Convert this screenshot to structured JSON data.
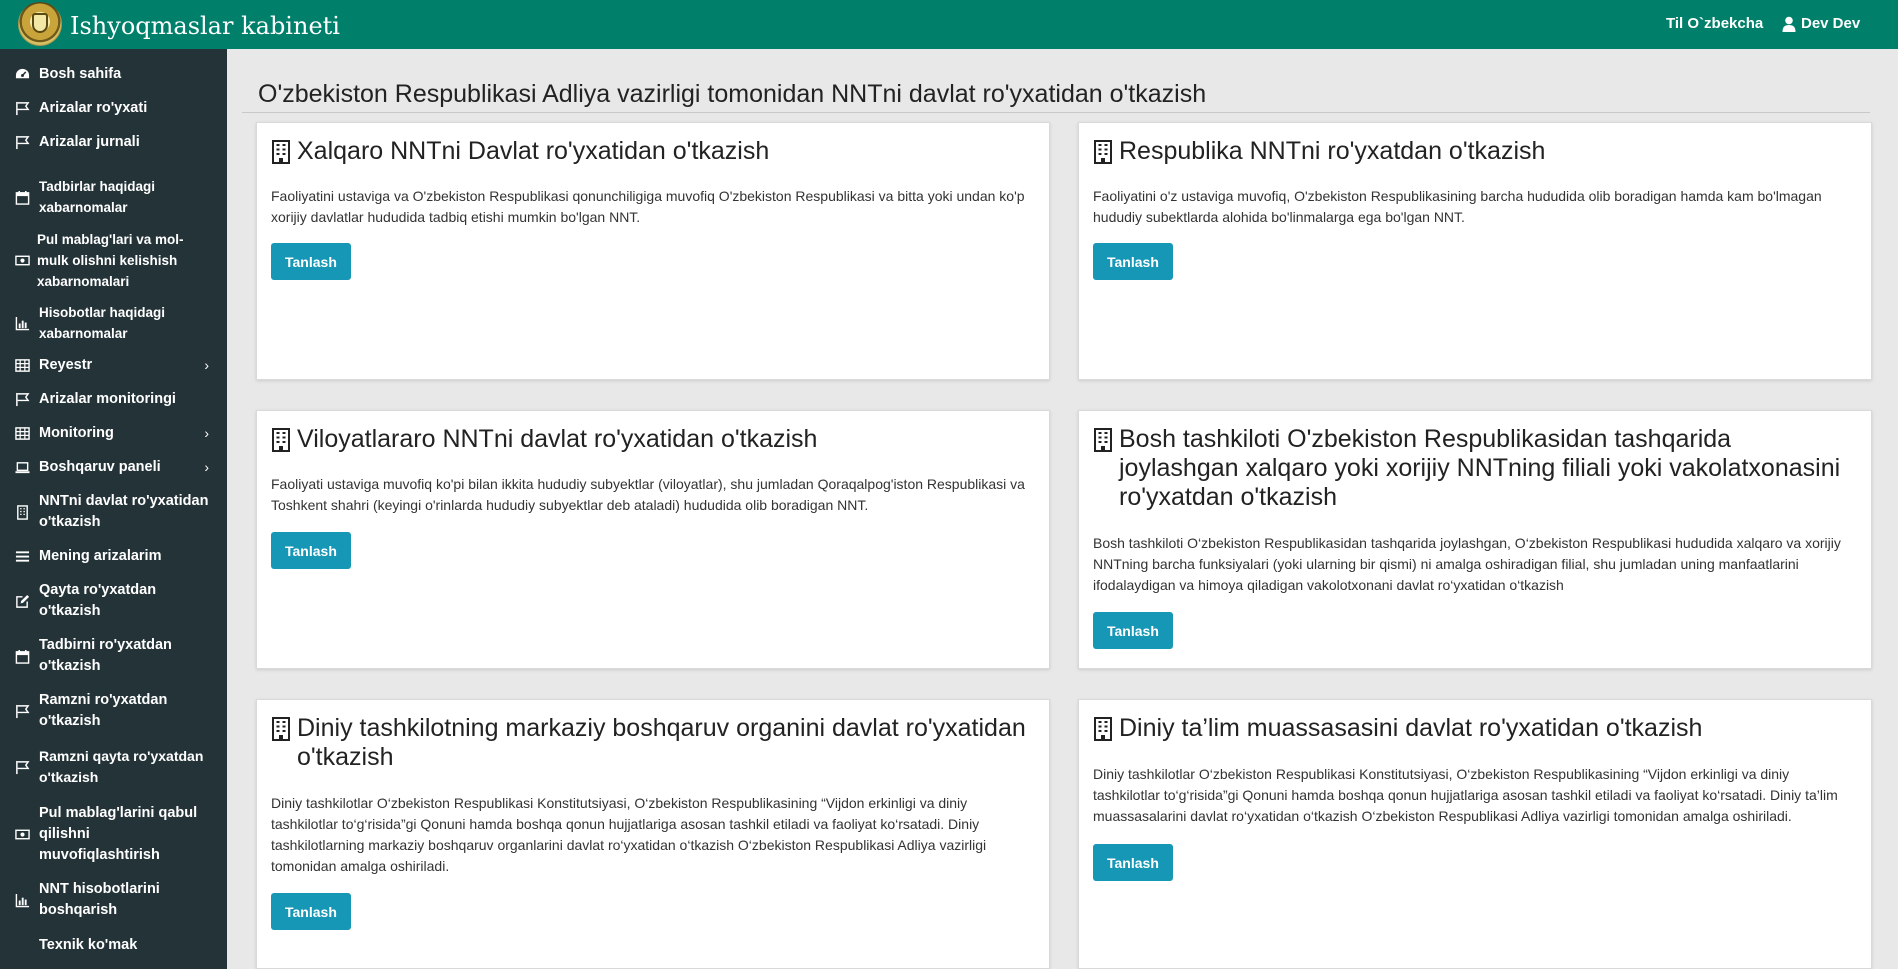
{
  "header": {
    "app_title": "Ishyoqmaslar kabineti",
    "language": "Til O`zbekcha",
    "user": "Dev Dev"
  },
  "colors": {
    "header": "#00806a",
    "sidebar": "#243338",
    "button": "#1797b6"
  },
  "sidebar": {
    "items": [
      {
        "label": "Bosh sahifa",
        "icon": "dashboard-icon"
      },
      {
        "label": "Arizalar ro'yxati",
        "icon": "flag-icon"
      },
      {
        "label": "Arizalar jurnali",
        "icon": "flag-icon"
      },
      {
        "label": "Tadbirlar haqidagi xabarnomalar",
        "icon": "calendar-icon"
      },
      {
        "label": "Pul mablag'lari va mol-mulk olishni kelishish xabarnomalari",
        "icon": "money-icon"
      },
      {
        "label": "Hisobotlar haqidagi xabarnomalar",
        "icon": "bar-chart-icon"
      },
      {
        "label": "Reyestr",
        "icon": "table-icon",
        "chevron": "›"
      },
      {
        "label": "Arizalar monitoringi",
        "icon": "flag-icon"
      },
      {
        "label": "Monitoring",
        "icon": "table-icon",
        "chevron": "›"
      },
      {
        "label": "Boshqaruv paneli",
        "icon": "laptop-icon",
        "chevron": "›"
      },
      {
        "label": "NNTni davlat ro'yxatidan o'tkazish",
        "icon": "building-icon"
      },
      {
        "label": "Mening arizalarim",
        "icon": "list-icon"
      },
      {
        "label": "Qayta ro'yxatdan o'tkazish",
        "icon": "edit-icon"
      },
      {
        "label": "Tadbirni ro'yxatdan o'tkazish",
        "icon": "calendar-icon"
      },
      {
        "label": "Ramzni ro'yxatdan o'tkazish",
        "icon": "flag-icon"
      },
      {
        "label": "Ramzni qayta ro'yxatdan o'tkazish",
        "icon": "flag-icon"
      },
      {
        "label": "Pul mablag'larini qabul qilishni muvofiqlashtirish",
        "icon": "money-icon"
      },
      {
        "label": "NNT hisobotlarini boshqarish",
        "icon": "bar-chart-icon"
      },
      {
        "label": "Texnik ko'mak",
        "icon": "help-icon"
      }
    ]
  },
  "main": {
    "page_title": "O'zbekiston Respublikasi Adliya vazirligi tomonidan NNTni davlat ro'yxatidan o'tkazish",
    "button_label": "Tanlash",
    "cards": [
      {
        "title": "Xalqaro NNTni Davlat ro'yxatidan o'tkazish",
        "description": "Faoliyatini ustaviga va O'zbekiston Respublikasi qonunchiligiga muvofiq O'zbekiston Respublikasi va bitta yoki undan ko'p xorijiy davlatlar hududida tadbiq etishi mumkin bo'lgan NNT."
      },
      {
        "title": "Respublika NNTni ro'yxatdan o'tkazish",
        "description": "Faoliyatini o'z ustaviga muvofiq, O'zbekiston Respublikasining barcha hududida olib boradigan hamda kam bo'lmagan hududiy subektlarda alohida bo'linmalarga ega bo'lgan NNT."
      },
      {
        "title": "Viloyatlararo NNTni davlat ro'yxatidan o'tkazish",
        "description": "Faoliyati ustaviga muvofiq ko'pi bilan ikkita hududiy subyektlar (viloyatlar), shu jumladan Qoraqalpog'iston Respublikasi va Toshkent shahri (keyingi o'rinlarda hududiy subyektlar deb ataladi) hududida olib boradigan NNT."
      },
      {
        "title": "Bosh tashkiloti O'zbekiston Respublikasidan tashqarida joylashgan xalqaro yoki xorijiy NNTning filiali yoki vakolatxonasini ro'yxatdan o'tkazish",
        "description": "Bosh tashkiloti O‘zbekiston Respublikasidan tashqarida joylashgan, O‘zbekiston Respublikasi hududida xalqaro va xorijiy NNTning barcha funksiyalari (yoki ularning bir qismi) ni amalga oshiradigan filial, shu jumladan uning manfaatlarini ifodalaydigan va himoya qiladigan vakolotxonani davlat ro‘yxatidan o‘tkazish"
      },
      {
        "title": "Diniy tashkilotning markaziy boshqaruv organini davlat ro'yxatidan o'tkazish",
        "description": "Diniy tashkilotlar O‘zbekiston Respublikasi Konstitutsiyasi, O‘zbekiston Respublikasining “Vijdon erkinligi va diniy tashkilotlar to‘g‘risida”gi Qonuni hamda boshqa qonun hujjatlariga asosan tashkil etiladi va faoliyat ko‘rsatadi. Diniy tashkilotlarning markaziy boshqaruv organlarini davlat ro‘yxatidan o‘tkazish O‘zbekiston Respublikasi Adliya vazirligi tomonidan amalga oshiriladi."
      },
      {
        "title": "Diniy ta’lim muassasasini davlat ro'yxatidan o'tkazish",
        "description": "Diniy tashkilotlar O‘zbekiston Respublikasi Konstitutsiyasi, O‘zbekiston Respublikasining “Vijdon erkinligi va diniy tashkilotlar to‘g‘risida”gi Qonuni hamda boshqa qonun hujjatlariga asosan tashkil etiladi va faoliyat ko‘rsatadi. Diniy ta’lim muassasalarini davlat ro‘yxatidan o‘tkazish O‘zbekiston Respublikasi Adliya vazirligi tomonidan amalga oshiriladi."
      }
    ]
  }
}
